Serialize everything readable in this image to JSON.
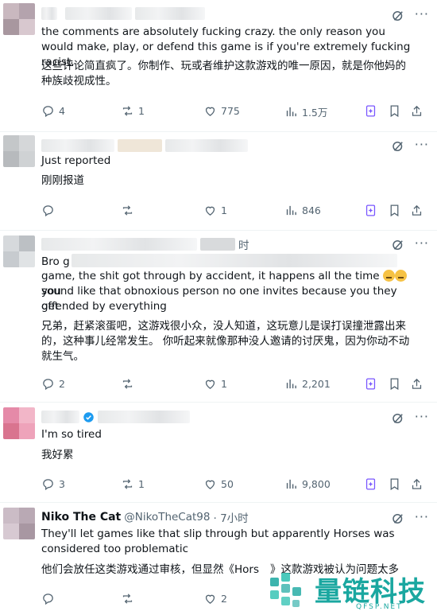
{
  "tweets": [
    {
      "id": "t1",
      "author_handle_visible": "",
      "text_en": "the comments are absolutely fucking crazy. the only reason you would make, play, or defend this game is if you're extremely fucking racist.",
      "text_zh": "这些评论简直疯了。你制作、玩或者维护这款游戏的唯一原因，就是你他妈的种族歧视成性。",
      "stats": {
        "replies": "4",
        "reposts": "1",
        "likes": "775",
        "views": "1.5万"
      }
    },
    {
      "id": "t2",
      "text_en": "Just reported",
      "text_zh": "刚刚报道",
      "stats": {
        "replies": "",
        "reposts": "",
        "likes": "1",
        "views": "846"
      }
    },
    {
      "id": "t3",
      "time_suffix": "时",
      "text_en_l1": "Bro g",
      "text_en_l2": "game, the shit got through by accident, it happens all the time",
      "text_en_l2b": "you",
      "text_en_l3": "sound like that obnoxious person no one invites because you they get",
      "text_en_l4": "offended by everything",
      "text_zh": "兄弟，赶紧滚蛋吧，这游戏很小众，没人知道，这玩意儿是误打误撞泄露出来的，这种事儿经常发生。 你听起来就像那种没人邀请的讨厌鬼，因为你动不动就生气。",
      "stats": {
        "replies": "2",
        "reposts": "",
        "likes": "1",
        "views": "2,201"
      }
    },
    {
      "id": "t4",
      "text_en": "I'm so tired",
      "text_zh": "我好累",
      "stats": {
        "replies": "3",
        "reposts": "1",
        "likes": "50",
        "views": "9,800"
      }
    },
    {
      "id": "t5",
      "name": "Niko The Cat",
      "handle": "@NikoTheCat98",
      "time": "· 7小时",
      "text_en": "They'll let games like that slip through but apparently Horses was considered too problematic",
      "text_zh": "他们会放任这类游戏通过审核，但显然《Hors",
      "text_zh_tail": "》这款游戏被认为问题太多",
      "stats": {
        "replies": "",
        "reposts": "",
        "likes": "2",
        "views": ""
      }
    }
  ],
  "watermark": {
    "brand": "量链科技",
    "url": "QFSP.NET"
  },
  "colors": {
    "accent": "#1d9bf0",
    "muted": "#536471",
    "grok_purple": "#7856ff",
    "watermark": "#1aa7a0"
  },
  "icons": [
    "reply-icon",
    "repost-icon",
    "like-icon",
    "views-icon",
    "grok-icon",
    "bookmark-icon",
    "share-icon",
    "more-icon",
    "verified-icon"
  ]
}
